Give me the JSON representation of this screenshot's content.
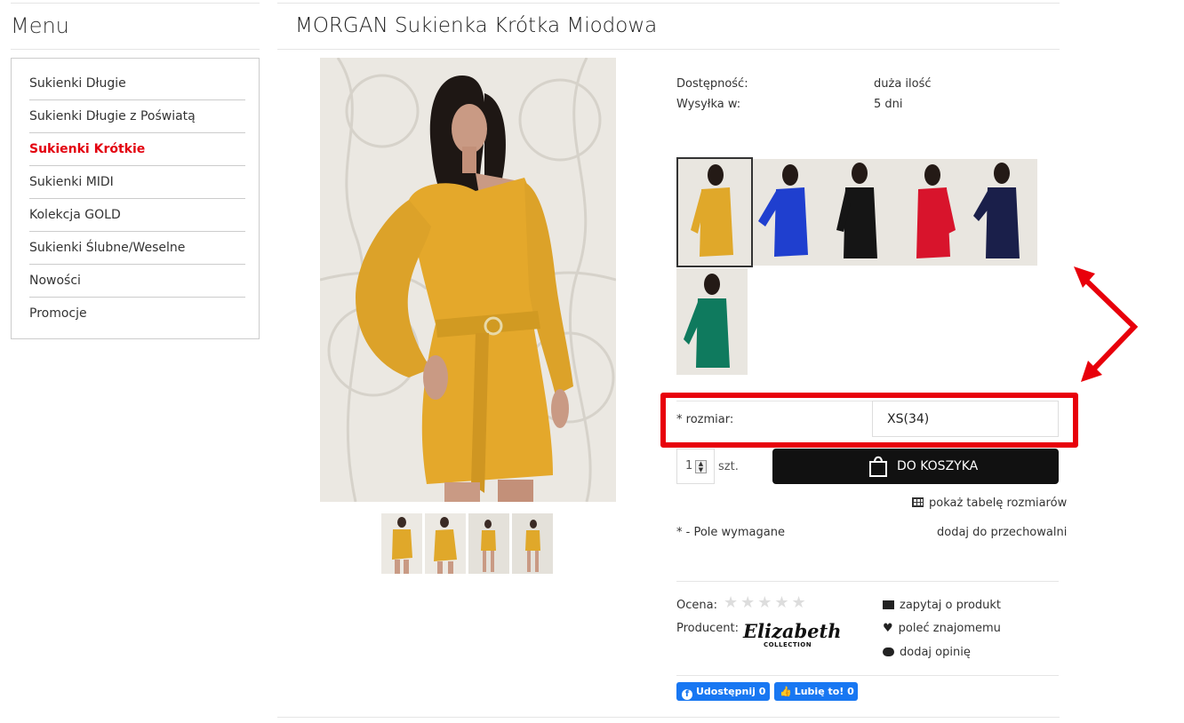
{
  "sidebar": {
    "title": "Menu",
    "items": [
      {
        "label": "Sukienki Długie",
        "active": false
      },
      {
        "label": "Sukienki Długie z Poświatą",
        "active": false
      },
      {
        "label": "Sukienki Krótkie",
        "active": true
      },
      {
        "label": "Sukienki MIDI",
        "active": false
      },
      {
        "label": "Kolekcja GOLD",
        "active": false
      },
      {
        "label": "Sukienki Ślubne/Weselne",
        "active": false
      },
      {
        "label": "Nowości",
        "active": false
      },
      {
        "label": "Promocje",
        "active": false
      }
    ]
  },
  "product": {
    "title": "MORGAN Sukienka Krótka Miodowa",
    "availability_label": "Dostępność:",
    "availability_value": "duża ilość",
    "shipping_label": "Wysyłka w:",
    "shipping_value": "5 dni",
    "colors": [
      "#e0a82a",
      "#1f3fcf",
      "#151515",
      "#d8142c",
      "#1a1f4a",
      "#0f7a5e"
    ],
    "size_label": "* rozmiar:",
    "size_value": "XS(34)",
    "qty_value": "1",
    "qty_unit": "szt.",
    "cart_button": "DO KOSZYKA",
    "size_table_link": "pokaż tabelę rozmiarów",
    "required_note": "* - Pole wymagane",
    "wishlist_link": "dodaj do przechowalni",
    "rating_label": "Ocena:",
    "rating": 0,
    "rating_max": 5,
    "producer_label": "Producent:",
    "producer_logo_main": "Elizabeth",
    "producer_logo_sub": "COLLECTION",
    "ask_link": "zapytaj o produkt",
    "recommend_link": "poleć znajomemu",
    "review_link": "dodaj opinię",
    "fb_share": "Udostępnij 0",
    "fb_like": "Lubię to! 0"
  },
  "colors": {
    "accent_red": "#e3000f",
    "highlight_red": "#e8000b",
    "button_dark": "#111111",
    "facebook_blue": "#1877f2"
  }
}
